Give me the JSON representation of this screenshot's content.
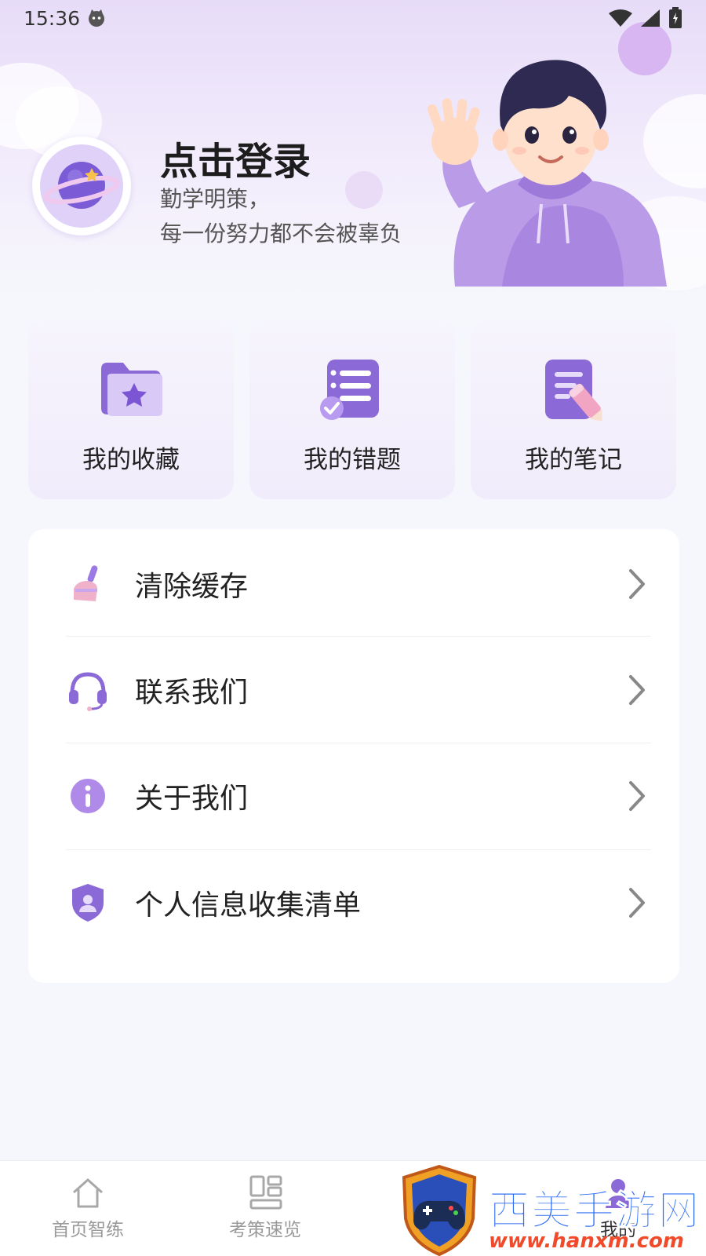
{
  "status_bar": {
    "time": "15:36"
  },
  "profile": {
    "login_title": "点击登录",
    "motto_line1": "勤学明策，",
    "motto_line2": "每一份努力都不会被辜负"
  },
  "quick_actions": [
    {
      "label": "我的收藏",
      "icon": "star-folder-icon"
    },
    {
      "label": "我的错题",
      "icon": "checklist-icon"
    },
    {
      "label": "我的笔记",
      "icon": "notepad-pencil-icon"
    }
  ],
  "menu": [
    {
      "label": "清除缓存",
      "icon": "broom-icon"
    },
    {
      "label": "联系我们",
      "icon": "headset-icon"
    },
    {
      "label": "关于我们",
      "icon": "info-icon"
    },
    {
      "label": "个人信息收集清单",
      "icon": "shield-user-icon"
    }
  ],
  "tabbar": [
    {
      "label": "首页智练",
      "icon": "home-icon"
    },
    {
      "label": "考策速览",
      "icon": "grid-icon"
    },
    {
      "label": "我的",
      "icon": "user-icon"
    }
  ],
  "watermark": {
    "title": "西美手游网",
    "url": "www.hanxm.com"
  },
  "colors": {
    "accent": "#8a6be0",
    "header_bg": "#e7dcf8",
    "page_bg": "#f5f7fc"
  }
}
